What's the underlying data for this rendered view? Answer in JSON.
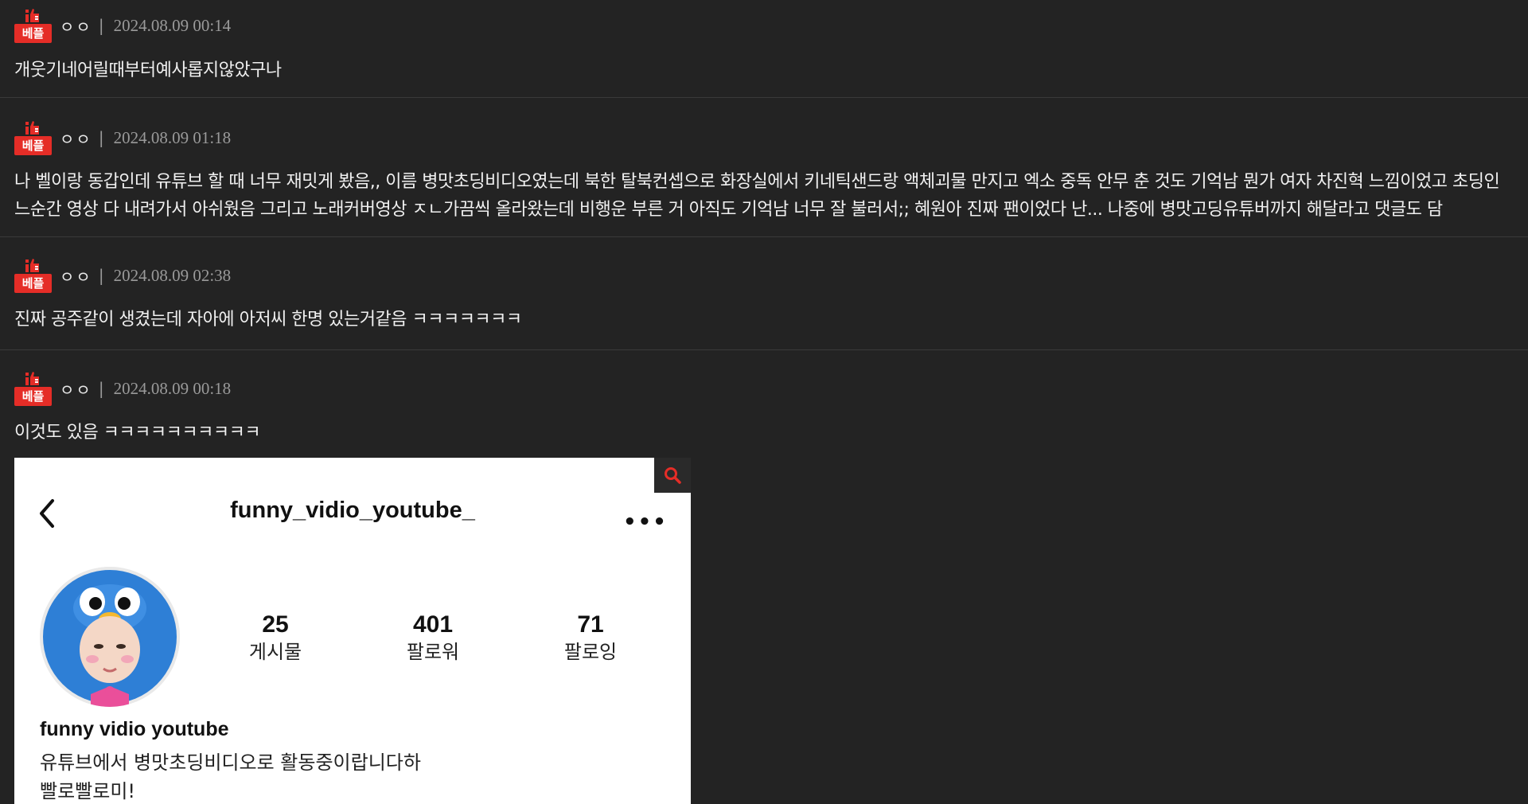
{
  "comments": [
    {
      "badge": "베플",
      "nick": "ㅇㅇ",
      "separator": "|",
      "date": "2024.08.09 00:14",
      "lines": [
        "개웃기네어릴때부터예사롭지않았구나"
      ]
    },
    {
      "badge": "베플",
      "nick": "ㅇㅇ",
      "separator": "|",
      "date": "2024.08.09 01:18",
      "lines": [
        "나 벨이랑 동갑인데 유튜브 할 때 너무 재밋게 봤음,, 이름 병맛초딩비디오였는데 북한 탈북컨셉으로 화장실에서 키네틱샌드랑 액체괴물 만지고 엑소 중독 안무 춘 것도 기억남 뭔가 여자 차진혁 느낌이었고 초딩인",
        "느순간 영상 다 내려가서 아쉬웠음 그리고 노래커버영상 ㅈㄴ가끔씩 올라왔는데 비행운 부른 거 아직도 기억남 너무 잘 불러서;; 혜원아 진짜 팬이었다 난... 나중에 병맛고딩유튜버까지 해달라고 댓글도 담"
      ]
    },
    {
      "badge": "베플",
      "nick": "ㅇㅇ",
      "separator": "|",
      "date": "2024.08.09 02:38",
      "lines": [
        "진짜 공주같이 생겼는데 자아에 아저씨 한명 있는거같음 ㅋㅋㅋㅋㅋㅋㅋ"
      ]
    },
    {
      "badge": "베플",
      "nick": "ㅇㅇ",
      "separator": "|",
      "date": "2024.08.09 00:18",
      "lines": [
        "이것도 있음 ㅋㅋㅋㅋㅋㅋㅋㅋㅋㅋ"
      ]
    }
  ],
  "embed": {
    "handle": "funny_vidio_youtube_",
    "more": "•••",
    "stats": [
      {
        "num": "25",
        "label": "게시물"
      },
      {
        "num": "401",
        "label": "팔로워"
      },
      {
        "num": "71",
        "label": "팔로잉"
      }
    ],
    "profile_name": "funny vidio youtube",
    "bio_lines": [
      "유튜브에서 병맛초딩비디오로 활동중이랍니다하",
      "빨로빨로미!"
    ]
  },
  "colors": {
    "background": "#232323",
    "badge": "#e52d27",
    "meta_gray": "#9a9a9a",
    "divider": "#3a3a3a"
  }
}
